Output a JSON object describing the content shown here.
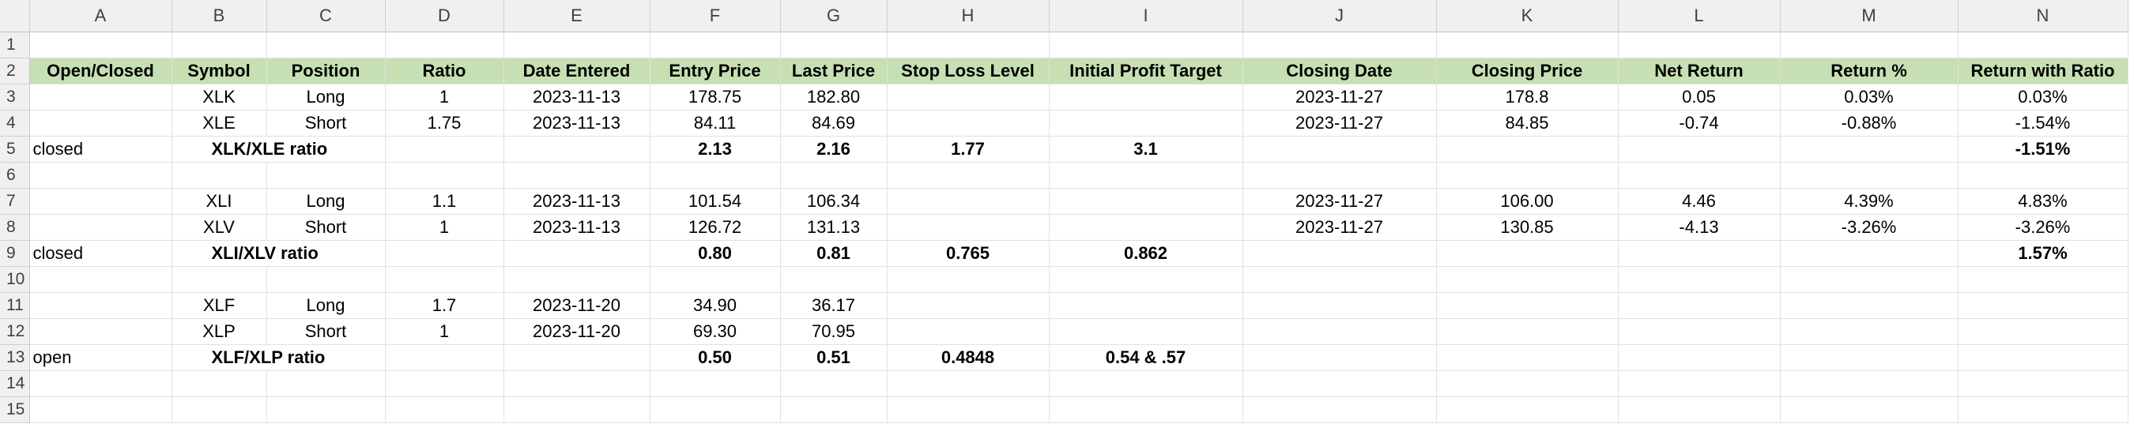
{
  "column_headers": [
    "A",
    "B",
    "C",
    "D",
    "E",
    "F",
    "G",
    "H",
    "I",
    "J",
    "K",
    "L",
    "M",
    "N"
  ],
  "row_numbers": [
    "1",
    "2",
    "3",
    "4",
    "5",
    "6",
    "7",
    "8",
    "9",
    "10",
    "11",
    "12",
    "13",
    "14",
    "15"
  ],
  "header_row": {
    "open_closed": "Open/Closed",
    "symbol": "Symbol",
    "position": "Position",
    "ratio": "Ratio",
    "date_entered": "Date Entered",
    "entry_price": "Entry Price",
    "last_price": "Last Price",
    "stop_loss": "Stop Loss Level",
    "profit_target": "Initial Profit Target",
    "closing_date": "Closing Date",
    "closing_price": "Closing Price",
    "net_return": "Net Return",
    "return_pct": "Return %",
    "return_with_ratio": "Return with Ratio"
  },
  "pairs": [
    {
      "legs": [
        {
          "symbol": "XLK",
          "position": "Long",
          "ratio": "1",
          "date_entered": "2023-11-13",
          "entry_price": "178.75",
          "last_price": "182.80",
          "closing_date": "2023-11-27",
          "closing_price": "178.8",
          "net_return": "0.05",
          "return_pct": "0.03%",
          "return_with_ratio": "0.03%"
        },
        {
          "symbol": "XLE",
          "position": "Short",
          "ratio": "1.75",
          "date_entered": "2023-11-13",
          "entry_price": "84.11",
          "last_price": "84.69",
          "closing_date": "2023-11-27",
          "closing_price": "84.85",
          "net_return": "-0.74",
          "return_pct": "-0.88%",
          "return_with_ratio": "-1.54%"
        }
      ],
      "summary": {
        "status": "closed",
        "label": "XLK/XLE ratio",
        "entry_price": "2.13",
        "last_price": "2.16",
        "stop_loss": "1.77",
        "profit_target": "3.1",
        "return_with_ratio": "-1.51%"
      }
    },
    {
      "legs": [
        {
          "symbol": "XLI",
          "position": "Long",
          "ratio": "1.1",
          "date_entered": "2023-11-13",
          "entry_price": "101.54",
          "last_price": "106.34",
          "closing_date": "2023-11-27",
          "closing_price": "106.00",
          "net_return": "4.46",
          "return_pct": "4.39%",
          "return_with_ratio": "4.83%"
        },
        {
          "symbol": "XLV",
          "position": "Short",
          "ratio": "1",
          "date_entered": "2023-11-13",
          "entry_price": "126.72",
          "last_price": "131.13",
          "closing_date": "2023-11-27",
          "closing_price": "130.85",
          "net_return": "-4.13",
          "return_pct": "-3.26%",
          "return_with_ratio": "-3.26%"
        }
      ],
      "summary": {
        "status": "closed",
        "label": "XLI/XLV ratio",
        "entry_price": "0.80",
        "last_price": "0.81",
        "stop_loss": "0.765",
        "profit_target": "0.862",
        "return_with_ratio": "1.57%"
      }
    },
    {
      "legs": [
        {
          "symbol": "XLF",
          "position": "Long",
          "ratio": "1.7",
          "date_entered": "2023-11-20",
          "entry_price": "34.90",
          "last_price": "36.17",
          "closing_date": "",
          "closing_price": "",
          "net_return": "",
          "return_pct": "",
          "return_with_ratio": ""
        },
        {
          "symbol": "XLP",
          "position": "Short",
          "ratio": "1",
          "date_entered": "2023-11-20",
          "entry_price": "69.30",
          "last_price": "70.95",
          "closing_date": "",
          "closing_price": "",
          "net_return": "",
          "return_pct": "",
          "return_with_ratio": ""
        }
      ],
      "summary": {
        "status": "open",
        "label": "XLF/XLP ratio",
        "entry_price": "0.50",
        "last_price": "0.51",
        "stop_loss": "0.4848",
        "profit_target": "0.54 & .57",
        "return_with_ratio": ""
      }
    }
  ],
  "colors": {
    "header_fill": "#c6e0b4",
    "grid": "#e1e1e1",
    "headings_bg": "#f0f0f0"
  }
}
